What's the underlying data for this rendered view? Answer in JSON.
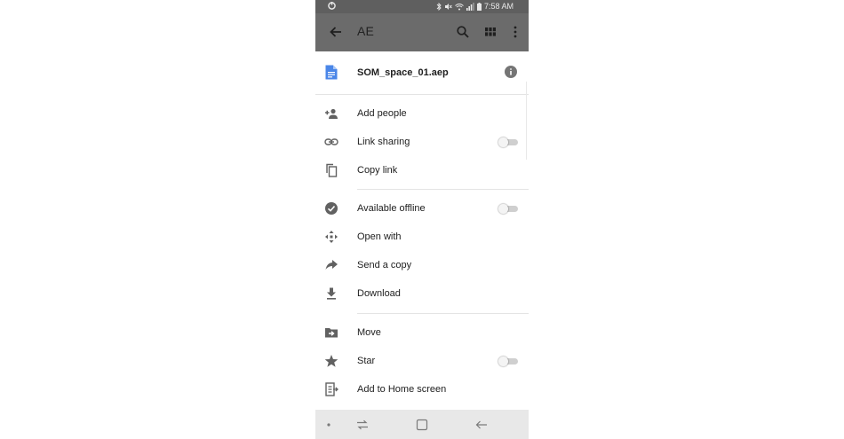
{
  "status_bar": {
    "time": "7:58 AM"
  },
  "app_bar": {
    "title": "AE"
  },
  "file": {
    "name": "SOM_space_01.aep"
  },
  "menu": {
    "add_people": "Add people",
    "link_sharing": "Link sharing",
    "copy_link": "Copy link",
    "available_offline": "Available offline",
    "open_with": "Open with",
    "send_a_copy": "Send a copy",
    "download": "Download",
    "move": "Move",
    "star": "Star",
    "add_to_home_screen": "Add to Home screen"
  },
  "toggles": {
    "link_sharing": false,
    "available_offline": false,
    "star": false
  },
  "colors": {
    "file_icon": "#4a86e8",
    "icon": "#616161",
    "app_bar": "#6b6b6b",
    "status_bar": "#5f5f5f"
  },
  "icons": {
    "status_left": "sync-icon",
    "status_right": [
      "bluetooth-icon",
      "mute-icon",
      "wifi-icon",
      "signal-icon",
      "battery-icon"
    ],
    "app_bar": [
      "back-arrow-icon",
      "search-icon",
      "grid-view-icon",
      "more-vert-icon"
    ],
    "nav_bar": [
      "dot-icon",
      "recent-apps-icon",
      "home-icon",
      "back-icon"
    ]
  }
}
